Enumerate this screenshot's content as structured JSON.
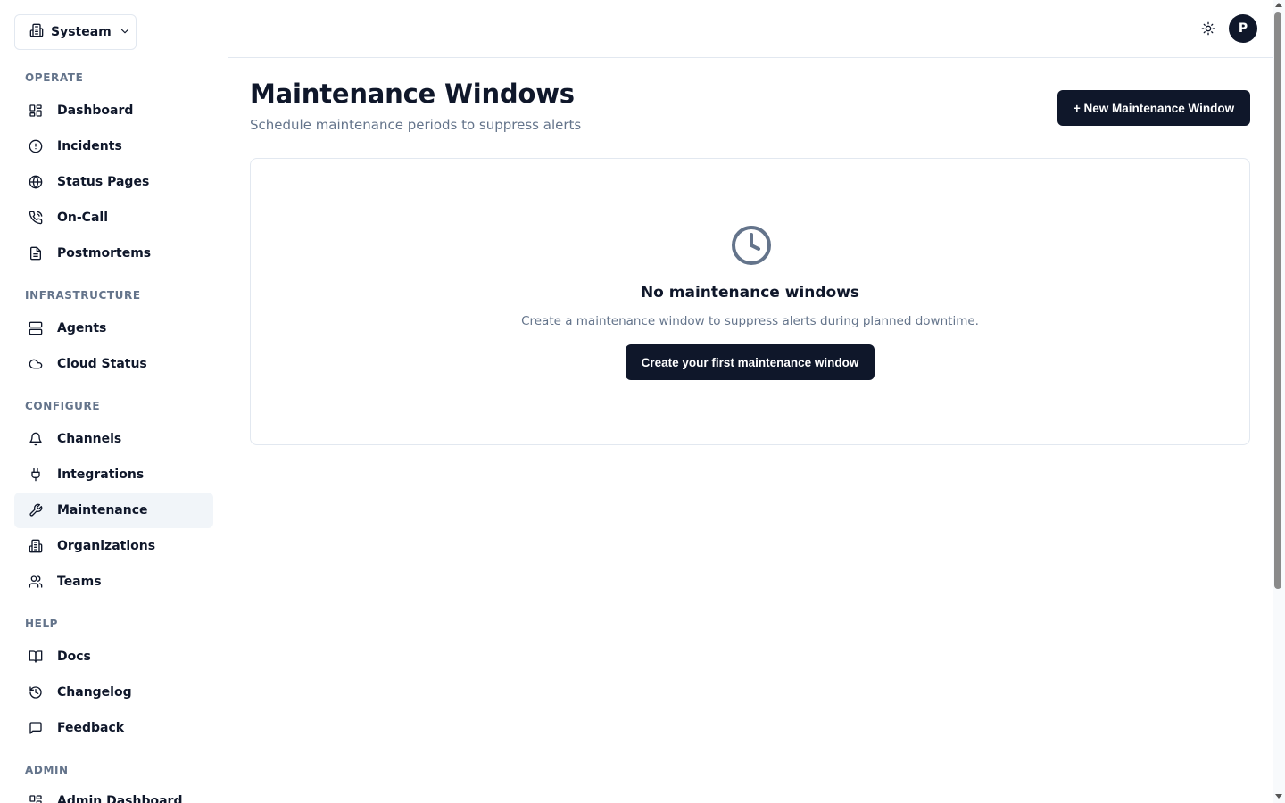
{
  "org_switcher": {
    "label": "Systeam",
    "icon": "building-icon"
  },
  "sidebar": {
    "sections": [
      {
        "title": "OPERATE",
        "items": [
          {
            "label": "Dashboard",
            "icon": "dashboard-icon"
          },
          {
            "label": "Incidents",
            "icon": "alert-circle-icon"
          },
          {
            "label": "Status Pages",
            "icon": "globe-icon"
          },
          {
            "label": "On-Call",
            "icon": "phone-icon"
          },
          {
            "label": "Postmortems",
            "icon": "file-text-icon"
          }
        ]
      },
      {
        "title": "INFRASTRUCTURE",
        "items": [
          {
            "label": "Agents",
            "icon": "server-icon"
          },
          {
            "label": "Cloud Status",
            "icon": "cloud-icon"
          }
        ]
      },
      {
        "title": "CONFIGURE",
        "items": [
          {
            "label": "Channels",
            "icon": "bell-icon"
          },
          {
            "label": "Integrations",
            "icon": "plug-icon"
          },
          {
            "label": "Maintenance",
            "icon": "wrench-icon",
            "active": true
          },
          {
            "label": "Organizations",
            "icon": "building-icon"
          },
          {
            "label": "Teams",
            "icon": "users-icon"
          }
        ]
      },
      {
        "title": "HELP",
        "items": [
          {
            "label": "Docs",
            "icon": "book-icon"
          },
          {
            "label": "Changelog",
            "icon": "history-icon"
          },
          {
            "label": "Feedback",
            "icon": "message-square-icon"
          }
        ]
      },
      {
        "title": "ADMIN",
        "items": [
          {
            "label": "Admin Dashboard",
            "icon": "dashboard-icon"
          }
        ]
      }
    ]
  },
  "topbar": {
    "theme_icon": "sun-icon",
    "avatar_initial": "P"
  },
  "main": {
    "title": "Maintenance Windows",
    "subtitle": "Schedule maintenance periods to suppress alerts",
    "new_button_label": "+ New Maintenance Window",
    "empty_state": {
      "icon": "clock-icon",
      "title": "No maintenance windows",
      "description": "Create a maintenance window to suppress alerts during planned downtime.",
      "button_label": "Create your first maintenance window"
    }
  },
  "colors": {
    "primary": "#0f172a",
    "muted": "#64748b",
    "border": "#e2e8f0",
    "active_bg": "#f1f5f9"
  }
}
